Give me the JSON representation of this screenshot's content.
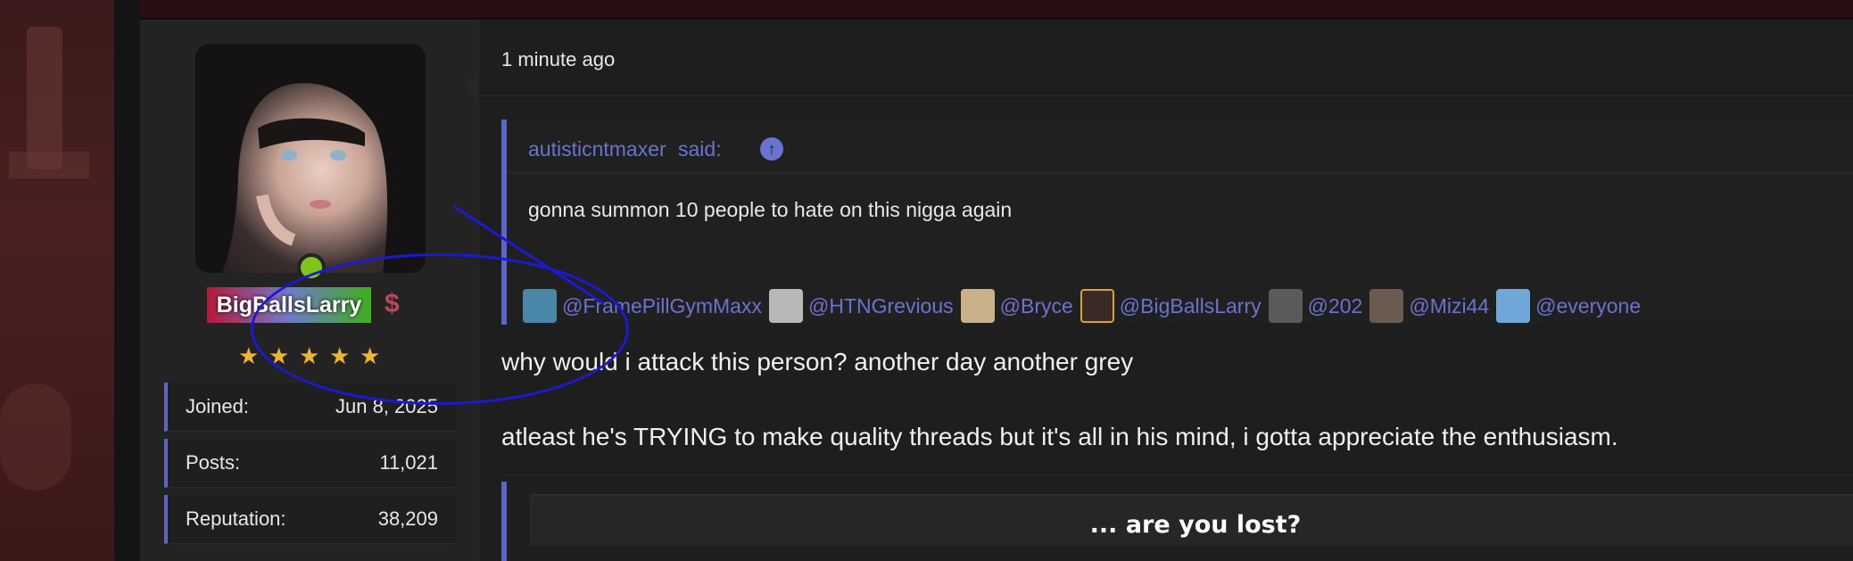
{
  "user": {
    "username": "BigBallsLarry",
    "badge_icon": "dollar-icon",
    "dollar_glyph": "$",
    "stars": 5,
    "star_glyph": "★",
    "stats": [
      {
        "label": "Joined:",
        "value": "Jun 8, 2025"
      },
      {
        "label": "Posts:",
        "value": "11,021"
      },
      {
        "label": "Reputation:",
        "value": "38,209"
      }
    ]
  },
  "post": {
    "timestamp": "1 minute ago",
    "quote": {
      "author": "autisticntmaxer",
      "said_label": "said:",
      "up_glyph": "↑",
      "body": "gonna summon 10 people to hate on this nigga again",
      "mentions": [
        {
          "name": "@FramePillGymMaxx",
          "color": "#4a86a8"
        },
        {
          "name": "@HTNGrevious",
          "color": "#b8b8b8"
        },
        {
          "name": "@Bryce",
          "color": "#c9b28a"
        },
        {
          "name": "@BigBallsLarry",
          "color": "#3a2a26"
        },
        {
          "name": "@202",
          "color": "#5a5a5a"
        },
        {
          "name": "@Mizi44",
          "color": "#6b5a50"
        },
        {
          "name": "@everyone",
          "color": "#6fa7d6"
        }
      ]
    },
    "message_1": "why would i attack this person? another day another grey",
    "message_2": "atleast he's TRYING to make quality threads but it's all in his mind, i gotta appreciate the enthusiasm.",
    "embedded_title": "... are you lost?"
  },
  "colors": {
    "accent": "#5c66c8",
    "link": "#6a73cf",
    "online": "#7fc31c",
    "annotation": "#1a1ad6"
  }
}
